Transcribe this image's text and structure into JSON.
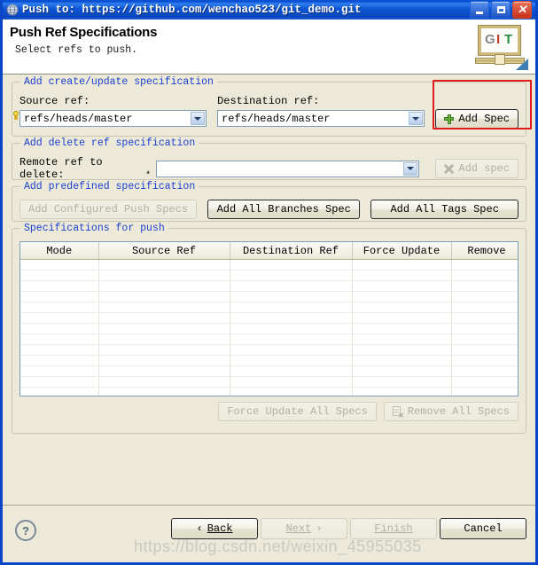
{
  "window": {
    "title": "Push to: https://github.com/wenchao523/git_demo.git",
    "icon": "globe-icon",
    "controls": {
      "minimize": "_",
      "maximize": "▢",
      "close": "✕"
    }
  },
  "header": {
    "title": "Push Ref Specifications",
    "subtitle": "Select refs to push.",
    "logo": {
      "g": "G",
      "i": "I",
      "t": "T",
      "g_color": "#8a8a8a",
      "i_color": "#c0392b",
      "t_color": "#27903f"
    }
  },
  "create_update": {
    "legend": "Add create/update specification",
    "source_label": "Source ref:",
    "source_value": "refs/heads/master",
    "destination_label": "Destination ref:",
    "destination_value": "refs/heads/master",
    "add_spec_button": "Add Spec"
  },
  "delete_spec": {
    "legend": "Add delete ref specification",
    "remote_label": "Remote ref to delete:",
    "remote_value": "",
    "remote_marker": "*",
    "add_spec_button": "Add spec"
  },
  "predefined": {
    "legend": "Add predefined specification",
    "configured_button": "Add Configured Push Specs",
    "branches_button": "Add All Branches Spec",
    "tags_button": "Add All Tags Spec"
  },
  "specifications": {
    "legend": "Specifications for push",
    "columns": [
      "Mode",
      "Source Ref",
      "Destination Ref",
      "Force Update",
      "Remove"
    ],
    "rows": [],
    "empty_row_count": 13,
    "force_update_all_button": "Force Update All Specs",
    "remove_all_button": "Remove All Specs"
  },
  "footer": {
    "help": "?",
    "back_button": "Back",
    "back_prefix": "‹",
    "next_button": "Next",
    "next_suffix": "›",
    "finish_button": "Finish",
    "cancel_button": "Cancel"
  },
  "annotation": {
    "color": "#e01b1b"
  },
  "watermark": "https://blog.csdn.net/weixin_45955035"
}
